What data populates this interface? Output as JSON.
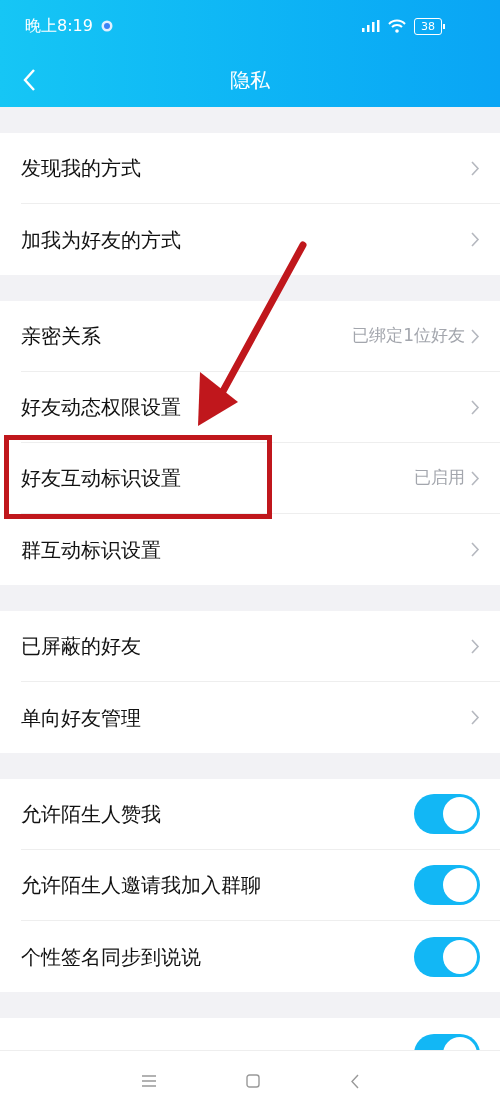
{
  "status_bar": {
    "time": "晚上8:19",
    "battery": "38"
  },
  "header": {
    "title": "隐私"
  },
  "groups": [
    {
      "rows": [
        {
          "kind": "link",
          "label": "发现我的方式"
        },
        {
          "kind": "link",
          "label": "加我为好友的方式"
        }
      ]
    },
    {
      "rows": [
        {
          "kind": "link",
          "label": "亲密关系",
          "value": "已绑定1位好友"
        },
        {
          "kind": "link",
          "label": "好友动态权限设置"
        },
        {
          "kind": "link",
          "label": "好友互动标识设置",
          "value": "已启用",
          "highlighted": true
        },
        {
          "kind": "link",
          "label": "群互动标识设置"
        }
      ]
    },
    {
      "rows": [
        {
          "kind": "link",
          "label": "已屏蔽的好友"
        },
        {
          "kind": "link",
          "label": "单向好友管理"
        }
      ]
    },
    {
      "rows": [
        {
          "kind": "toggle",
          "label": "允许陌生人赞我",
          "on": true
        },
        {
          "kind": "toggle",
          "label": "允许陌生人邀请我加入群聊",
          "on": true
        },
        {
          "kind": "toggle",
          "label": "个性签名同步到说说",
          "on": true
        }
      ]
    },
    {
      "rows": [
        {
          "kind": "toggle",
          "on": true
        }
      ]
    }
  ]
}
